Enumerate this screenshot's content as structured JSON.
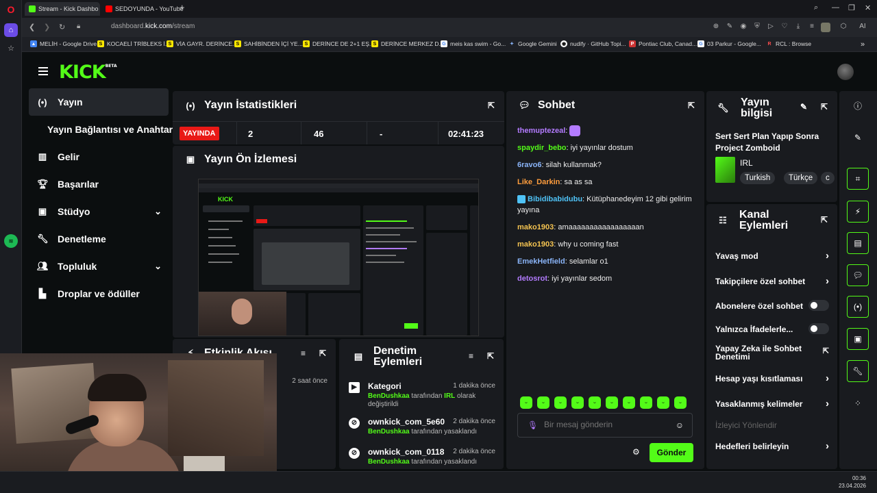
{
  "browser": {
    "tabs": [
      {
        "label": "Stream - Kick Dashbo",
        "icon": "kick-icon",
        "color": "#53fc18"
      },
      {
        "label": "SEDOYUNDA - YouTube",
        "icon": "youtube-icon",
        "color": "#ff0000"
      }
    ],
    "url_prefix": "dashboard.",
    "url_domain": "kick.com",
    "url_path": "/stream",
    "ai_label": "AI",
    "bookmarks": [
      {
        "label": "MELİH - Google Drive",
        "icon": "drive-icon"
      },
      {
        "label": "KOCAELİ TRİBLEKS İ...",
        "icon": "sahibinden-icon"
      },
      {
        "label": "VİA GAYR. DERİNCE...",
        "icon": "sahibinden-icon"
      },
      {
        "label": "SAHİBİNDEN İÇİ YE...",
        "icon": "sahibinden-icon"
      },
      {
        "label": "DERİNCE DE 2+1 EŞ...",
        "icon": "sahibinden-icon"
      },
      {
        "label": "DERİNCE MERKEZ D...",
        "icon": "sahibinden-icon"
      },
      {
        "label": "meis kas swim - Go...",
        "icon": "google-icon"
      },
      {
        "label": "Google Gemini",
        "icon": "gemini-icon"
      },
      {
        "label": "nudify · GitHub Topi...",
        "icon": "github-icon"
      },
      {
        "label": "Pontiac Club, Canad...",
        "icon": "pontiac-icon"
      },
      {
        "label": "03 Parkur - Google...",
        "icon": "google-icon"
      },
      {
        "label": "RCL : Browse",
        "icon": "rcl-icon"
      }
    ]
  },
  "kick": {
    "logo": "KICK",
    "logo_sup": "BETA",
    "nav": {
      "yayin": "Yayın",
      "yayin_sub": "Yayın Bağlantısı ve Anahtarı",
      "gelir": "Gelir",
      "basarilar": "Başarılar",
      "studyo": "Stüdyo",
      "denetleme": "Denetleme",
      "topluluk": "Topluluk",
      "droplar": "Droplar ve ödüller"
    },
    "stats": {
      "title": "Yayın İstatistikleri",
      "live": "YAYINDA",
      "viewers": "2",
      "followers": "46",
      "subs": "-",
      "duration": "02:41:23"
    },
    "preview": {
      "title": "Yayın Ön İzlemesi"
    },
    "activity": {
      "title": "Etkinlik Akışı",
      "time": "2 saat önce"
    },
    "mod_actions": {
      "title_line1": "Denetim",
      "title_line2": "Eylemleri",
      "entries": [
        {
          "title": "Kategori",
          "time": "1 dakika önce",
          "user": "BenDushkaa",
          "mid": " tarafından ",
          "target": "IRL",
          "end": " olarak değiştirildi"
        },
        {
          "title": "ownkick_com_5e60",
          "time": "2 dakika önce",
          "user": "BenDushkaa",
          "mid": " tarafından yasaklandı"
        },
        {
          "title": "ownkick_com_0118",
          "time": "2 dakika önce",
          "user": "BenDushkaa",
          "mid": " tarafından yasaklandı"
        }
      ]
    },
    "chat": {
      "title": "Sohbet",
      "messages": [
        {
          "user": "themuptezeal",
          "color": "#b37bff",
          "text": "",
          "emote": true
        },
        {
          "user": "spaydir_bebo",
          "color": "#53fc18",
          "text": "iyi yayınlar dostum"
        },
        {
          "user": "6ravo6",
          "color": "#8ab4f8",
          "text": "silah kullanmak?"
        },
        {
          "user": "Like_Darkin",
          "color": "#ff9d3d",
          "text": "sa as sa"
        },
        {
          "user": "Bibidibabidubu",
          "color": "#4fc3f7",
          "text": "Kütüphanedeyim 12 gibi gelirim yayına",
          "badge": true
        },
        {
          "user": "mako1903",
          "color": "#f5c451",
          "text": "amaaaaaaaaaaaaaaaaan"
        },
        {
          "user": "mako1903",
          "color": "#f5c451",
          "text": "why u coming fast"
        },
        {
          "user": "EmekHetfield",
          "color": "#8ab4f8",
          "text": "selamlar o1"
        },
        {
          "user": "detosrot",
          "color": "#b37bff",
          "text": "iyi yayınlar sedom"
        }
      ],
      "placeholder": "Bir mesaj gönderin",
      "send": "Gönder"
    },
    "info": {
      "title_line1": "Yayın",
      "title_line2": "bilgisi",
      "stream_title": "Sert Sert Plan Yapıp Sonra Project Zomboid",
      "category": "IRL",
      "tags": [
        "Turkish",
        "Türkçe",
        "c"
      ]
    },
    "channel_actions": {
      "title_line1": "Kanal",
      "title_line2": "Eylemleri",
      "items": {
        "slow": "Yavaş mod",
        "followers": "Takipçilere özel sohbet",
        "subs": "Abonelere özel sohbet",
        "emotes": "Yalnızca İfadelerle...",
        "ai_line1": "Yapay Zeka ile Sohbet",
        "ai_line2": "Denetimi",
        "age": "Hesap yaşı kısıtlaması",
        "banned": "Yasaklanmış kelimeler",
        "redirect": "İzleyici Yönlendir",
        "goals": "Hedefleri belirleyin"
      }
    }
  },
  "taskbar": {
    "time": "00:36",
    "date": "23.04.2026"
  }
}
